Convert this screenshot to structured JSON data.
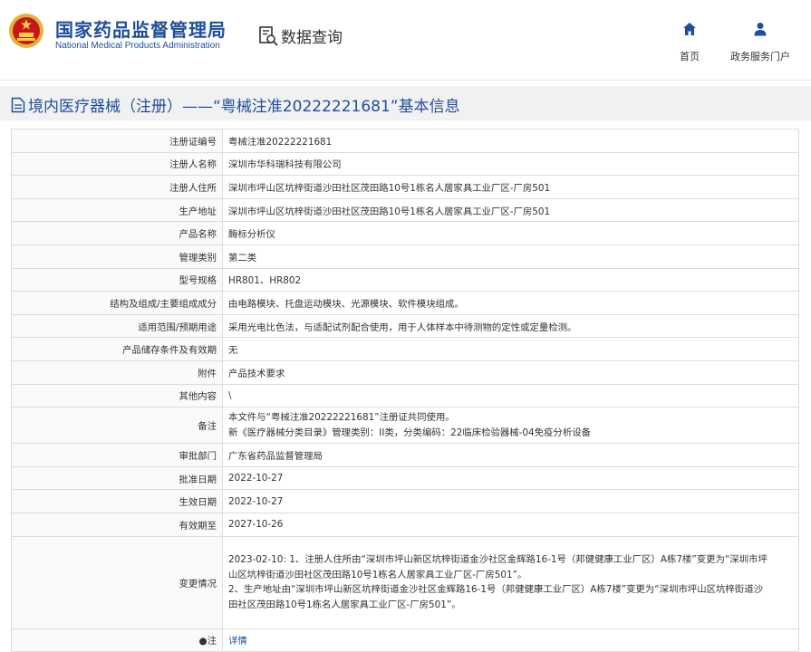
{
  "header": {
    "logo_cn": "国家药品监督管理局",
    "logo_en": "National Medical Products Administration",
    "query_label": "数据查询",
    "nav": [
      {
        "label": "首页",
        "icon": "home-icon"
      },
      {
        "label": "政务服务门户",
        "icon": "user-icon"
      }
    ]
  },
  "page_title": "境内医疗器械（注册）——“粤械注准20222221681”基本信息",
  "fields": [
    {
      "key": "注册证编号",
      "value": "粤械注准20222221681"
    },
    {
      "key": "注册人名称",
      "value": "深圳市华科瑞科技有限公司"
    },
    {
      "key": "注册人住所",
      "value": "深圳市坪山区坑梓街道沙田社区茂田路10号1栋名人居家具工业厂区-厂房501"
    },
    {
      "key": "生产地址",
      "value": "深圳市坪山区坑梓街道沙田社区茂田路10号1栋名人居家具工业厂区-厂房501"
    },
    {
      "key": "产品名称",
      "value": "酶标分析仪"
    },
    {
      "key": "管理类别",
      "value": "第二类"
    },
    {
      "key": "型号规格",
      "value": "HR801、HR802"
    },
    {
      "key": "结构及组成/主要组成成分",
      "value": "由电路模块、托盘运动模块、光源模块、软件模块组成。"
    },
    {
      "key": "适用范围/预期用途",
      "value": "采用光电比色法，与适配试剂配合使用，用于人体样本中待测物的定性或定量检测。"
    },
    {
      "key": "产品储存条件及有效期",
      "value": "无"
    },
    {
      "key": "附件",
      "value": "产品技术要求"
    },
    {
      "key": "其他内容",
      "value": "\\"
    },
    {
      "key": "备注",
      "value_lines": [
        "本文件与“粤械注准20222221681”注册证共同使用。",
        "新《医疗器械分类目录》管理类别：II类，分类编码：22临床检验器械-04免疫分析设备"
      ]
    },
    {
      "key": "审批部门",
      "value": "广东省药品监督管理局"
    },
    {
      "key": "批准日期",
      "value": "2022-10-27"
    },
    {
      "key": "生效日期",
      "value": "2022-10-27"
    },
    {
      "key": "有效期至",
      "value": "2027-10-26"
    },
    {
      "key": "变更情况",
      "value_lines": [
        "2023-02-10: 1、注册人住所由“深圳市坪山新区坑梓街道金沙社区金辉路16-1号（邦健健康工业厂区）A栋7楼”变更为“深圳市坪",
        "山区坑梓街道沙田社区茂田路10号1栋名人居家具工业厂区-厂房501”。",
        "2、生产地址由“深圳市坪山新区坑梓街道金沙社区金辉路16-1号（邦健健康工业厂区）A栋7楼”变更为“深圳市坪山区坑梓街道沙",
        "田社区茂田路10号1栋名人居家具工业厂区-厂房501”。"
      ]
    },
    {
      "key": "●注",
      "value": "详情",
      "value_is_link": true
    }
  ]
}
